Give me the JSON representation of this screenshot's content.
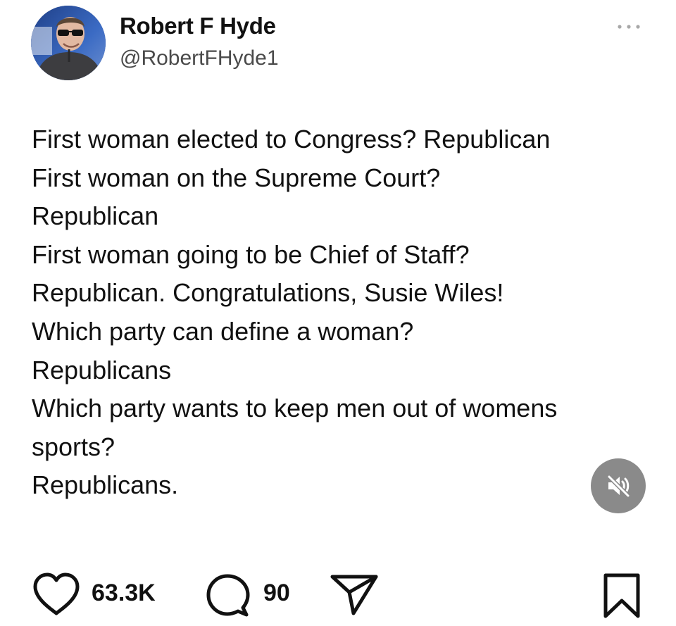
{
  "author": {
    "display_name": "Robert F Hyde",
    "handle": "@RobertFHyde1",
    "avatar_icon": "profile-photo"
  },
  "menu": {
    "icon": "more-dots-icon"
  },
  "post": {
    "lines": [
      "First woman elected to Congress? Republican",
      "First woman on the Supreme Court?",
      "Republican",
      "First woman going to be Chief of Staff?",
      "Republican. Congratulations, Susie Wiles!",
      "Which party can define a woman?",
      "Republicans",
      "Which party wants to keep men out of womens",
      "sports?",
      "Republicans."
    ]
  },
  "media": {
    "mute_icon": "speaker-muted-icon",
    "mute_button_color": "#8a8a8a"
  },
  "actions": {
    "likes": "63.3K",
    "comments": "90",
    "like_icon": "heart-icon",
    "comment_icon": "comment-bubble-icon",
    "share_icon": "send-icon",
    "save_icon": "bookmark-icon"
  },
  "colors": {
    "text": "#111111",
    "handle": "#4a4a4a",
    "background": "#ffffff"
  }
}
